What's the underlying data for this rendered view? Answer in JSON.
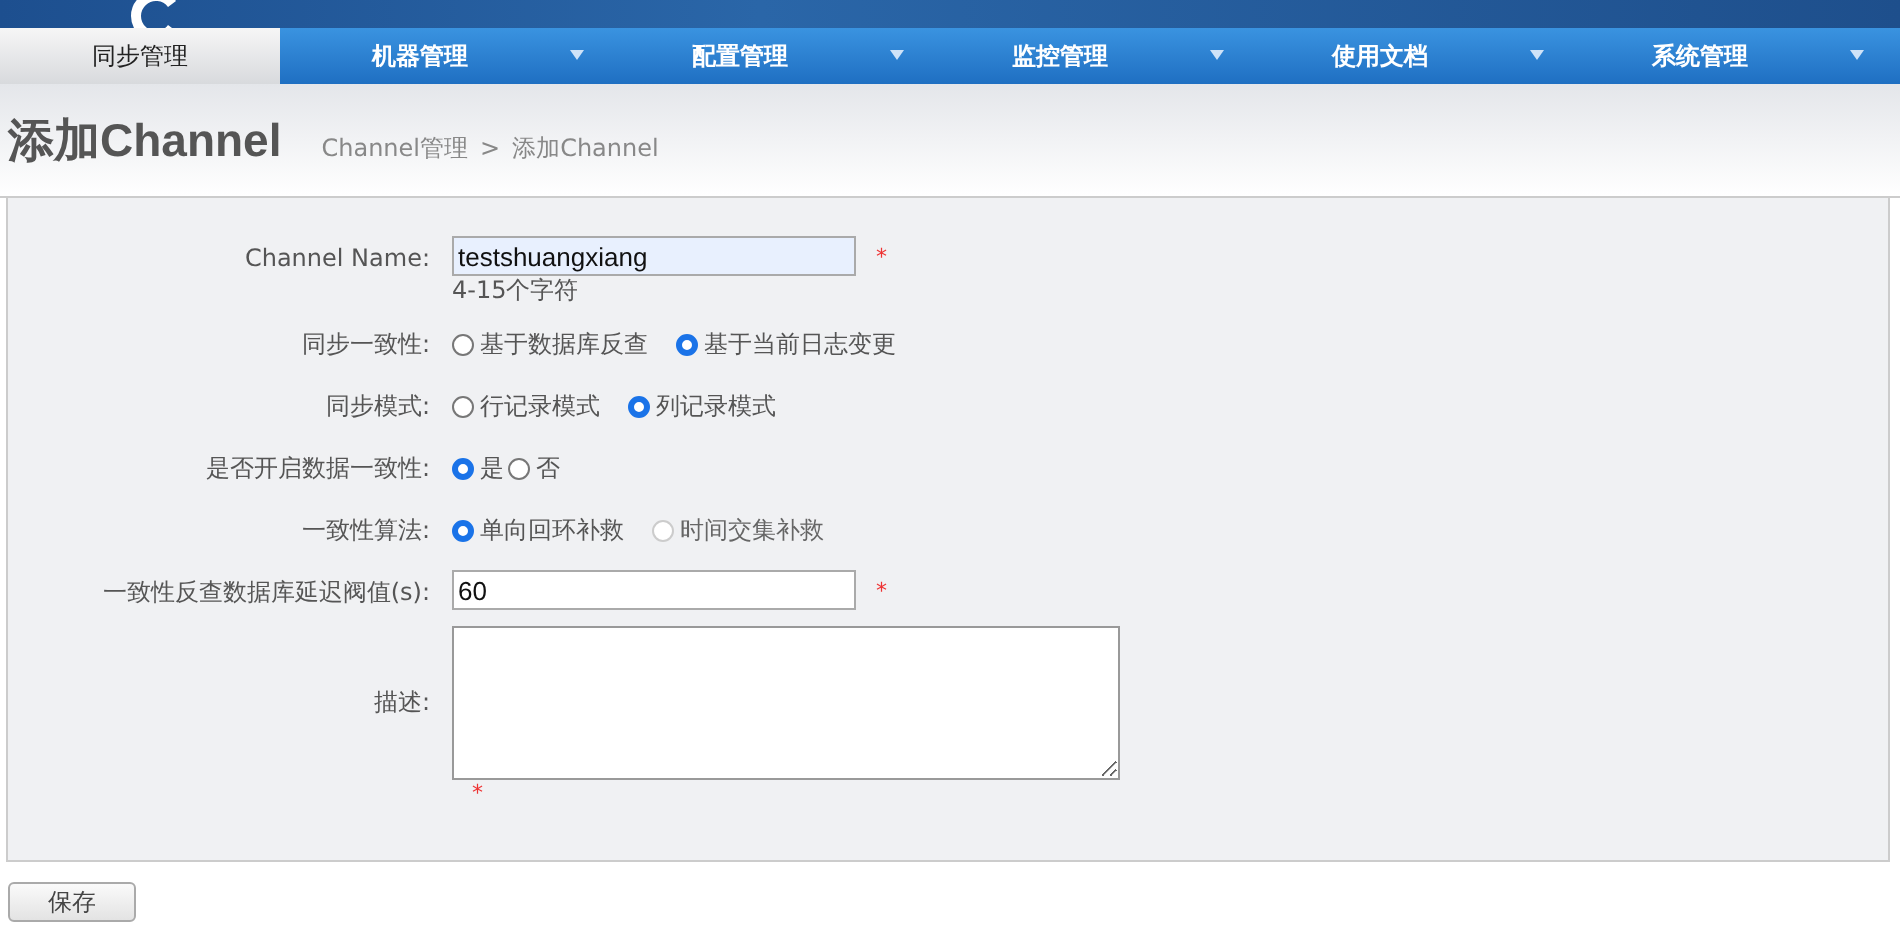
{
  "nav": [
    {
      "label": "同步管理",
      "selected": true,
      "has_menu": false
    },
    {
      "label": "机器管理",
      "selected": false,
      "has_menu": true
    },
    {
      "label": "配置管理",
      "selected": false,
      "has_menu": true
    },
    {
      "label": "监控管理",
      "selected": false,
      "has_menu": true
    },
    {
      "label": "使用文档",
      "selected": false,
      "has_menu": true
    },
    {
      "label": "系统管理",
      "selected": false,
      "has_menu": true
    }
  ],
  "page_title": "添加Channel",
  "breadcrumb": {
    "parent": "Channel管理",
    "separator": ">",
    "current": "添加Channel"
  },
  "form": [
    {
      "kind": "text",
      "label": "Channel Name:",
      "value": "testshuangxiang",
      "required_mark": "*",
      "hint": "4-15个字符",
      "highlighted": true
    },
    {
      "kind": "radio",
      "label": "同步一致性:",
      "options": [
        {
          "label": "基于数据库反查",
          "selected": false,
          "disabled": false
        },
        {
          "label": "基于当前日志变更",
          "selected": true,
          "disabled": false
        }
      ]
    },
    {
      "kind": "radio",
      "label": "同步模式:",
      "options": [
        {
          "label": "行记录模式",
          "selected": false,
          "disabled": false
        },
        {
          "label": "列记录模式",
          "selected": true,
          "disabled": false
        }
      ]
    },
    {
      "kind": "radio",
      "label": "是否开启数据一致性:",
      "compact": true,
      "options": [
        {
          "label": "是",
          "selected": true,
          "disabled": false
        },
        {
          "label": "否",
          "selected": false,
          "disabled": false
        }
      ]
    },
    {
      "kind": "radio",
      "label": "一致性算法:",
      "options": [
        {
          "label": "单向回环补救",
          "selected": true,
          "disabled": false
        },
        {
          "label": "时间交集补救",
          "selected": false,
          "disabled": true
        }
      ]
    },
    {
      "kind": "text",
      "label": "一致性反查数据库延迟阀值(s):",
      "value": "60",
      "required_mark": "*",
      "highlighted": false
    },
    {
      "kind": "textarea",
      "label": "描述:",
      "required_mark": "*"
    }
  ],
  "save_button": "保存"
}
